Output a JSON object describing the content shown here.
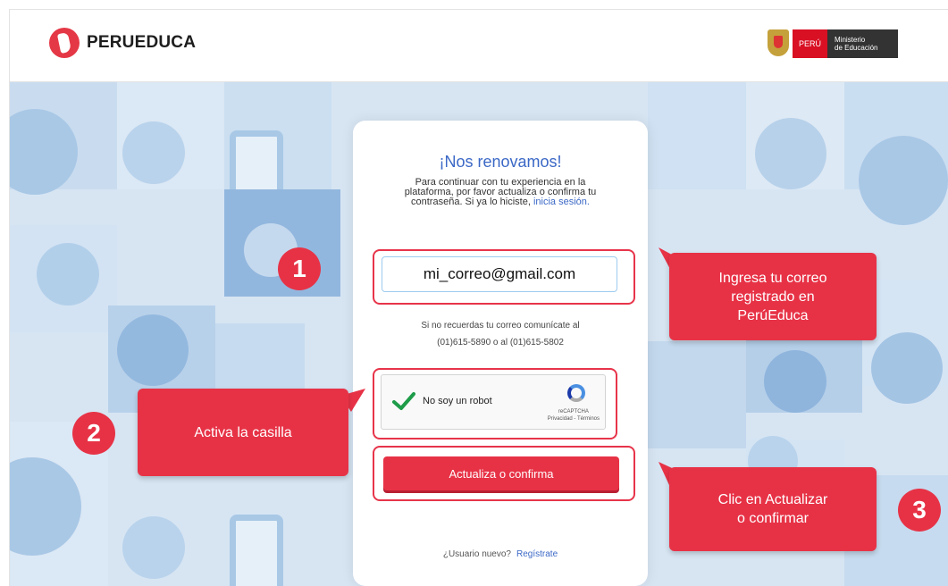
{
  "header": {
    "brand": "PERUEDUCA",
    "gov_country": "PERÚ",
    "gov_ministry_line1": "Ministerio",
    "gov_ministry_line2": "de Educación"
  },
  "form": {
    "title": "¡Nos renovamos!",
    "description_line1": "Para continuar con tu experiencia en la",
    "description_line2": "plataforma, por favor actualiza o confirma tu",
    "description_line3": "contraseña. Si ya lo hiciste,",
    "login_link": "inicia sesión.",
    "email_value": "mi_correo@gmail.com",
    "hint_line1": "Si no recuerdas tu correo comunícate al",
    "hint_line2": "(01)615-5890 o al (01)615-5802",
    "captcha_label": "No soy un robot",
    "captcha_brand": "reCAPTCHA",
    "captcha_links": "Privacidad - Términos",
    "submit_label": "Actualiza o confirma",
    "new_user_text": "¿Usuario nuevo?",
    "register_link": "Regístrate"
  },
  "annotations": {
    "step1_number": "1",
    "step1_line1": "Ingresa tu correo",
    "step1_line2": "registrado en",
    "step1_line3": "PerúEduca",
    "step2_number": "2",
    "step2_text": "Activa la casilla",
    "step3_number": "3",
    "step3_line1": "Clic en Actualizar",
    "step3_line2": "o confirmar"
  },
  "colors": {
    "accent": "#e73246",
    "link": "#3b68c6",
    "background": "#d7e5f3"
  }
}
